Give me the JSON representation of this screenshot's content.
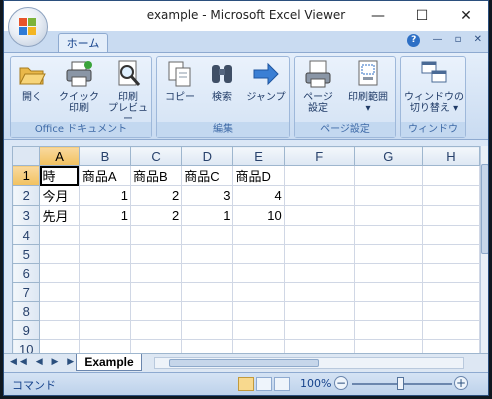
{
  "window": {
    "title": "example - Microsoft Excel Viewer"
  },
  "title_controls": {
    "minimize": "—",
    "maximize": "☐",
    "close": "✕"
  },
  "tabs": {
    "home": "ホーム"
  },
  "ribbon": {
    "groups": [
      {
        "label": "Office ドキュメント",
        "buttons": [
          {
            "line1": "開く",
            "line2": "",
            "icon": "folder-open-icon"
          },
          {
            "line1": "クイック",
            "line2": "印刷",
            "icon": "printer-icon"
          },
          {
            "line1": "印刷",
            "line2": "プレビュー",
            "icon": "print-preview-icon"
          }
        ]
      },
      {
        "label": "編集",
        "buttons": [
          {
            "line1": "コピー",
            "line2": "",
            "icon": "copy-icon"
          },
          {
            "line1": "検索",
            "line2": "",
            "icon": "binoculars-icon"
          },
          {
            "line1": "ジャンプ",
            "line2": "",
            "icon": "arrow-right-icon"
          }
        ]
      },
      {
        "label": "ページ設定",
        "buttons": [
          {
            "line1": "ページ",
            "line2": "設定",
            "icon": "page-setup-icon"
          },
          {
            "line1": "印刷範囲",
            "line2": "▾",
            "icon": "print-area-icon"
          }
        ]
      },
      {
        "label": "ウィンドウ",
        "buttons": [
          {
            "line1": "ウィンドウの",
            "line2": "切り替え ▾",
            "icon": "switch-windows-icon"
          }
        ]
      }
    ]
  },
  "grid": {
    "columns": [
      "A",
      "B",
      "C",
      "D",
      "E",
      "F",
      "G",
      "H"
    ],
    "rows": [
      {
        "num": "1",
        "cells": [
          "時",
          "商品A",
          "商品B",
          "商品C",
          "商品D",
          "",
          "",
          ""
        ]
      },
      {
        "num": "2",
        "cells": [
          "今月",
          "1",
          "2",
          "3",
          "4",
          "",
          "",
          ""
        ]
      },
      {
        "num": "3",
        "cells": [
          "先月",
          "1",
          "2",
          "1",
          "10",
          "",
          "",
          ""
        ]
      },
      {
        "num": "4",
        "cells": [
          "",
          "",
          "",
          "",
          "",
          "",
          "",
          ""
        ]
      },
      {
        "num": "5",
        "cells": [
          "",
          "",
          "",
          "",
          "",
          "",
          "",
          ""
        ]
      },
      {
        "num": "6",
        "cells": [
          "",
          "",
          "",
          "",
          "",
          "",
          "",
          ""
        ]
      },
      {
        "num": "7",
        "cells": [
          "",
          "",
          "",
          "",
          "",
          "",
          "",
          ""
        ]
      },
      {
        "num": "8",
        "cells": [
          "",
          "",
          "",
          "",
          "",
          "",
          "",
          ""
        ]
      },
      {
        "num": "9",
        "cells": [
          "",
          "",
          "",
          "",
          "",
          "",
          "",
          ""
        ]
      },
      {
        "num": "10",
        "cells": [
          "",
          "",
          "",
          "",
          "",
          "",
          "",
          ""
        ]
      }
    ]
  },
  "sheet_tabs": [
    "Example"
  ],
  "sheet_nav": "◀◀ ◀ ▶ ▶▶",
  "status": {
    "mode": "コマンド",
    "zoom": "100%",
    "zoom_minus": "−",
    "zoom_plus": "+"
  }
}
